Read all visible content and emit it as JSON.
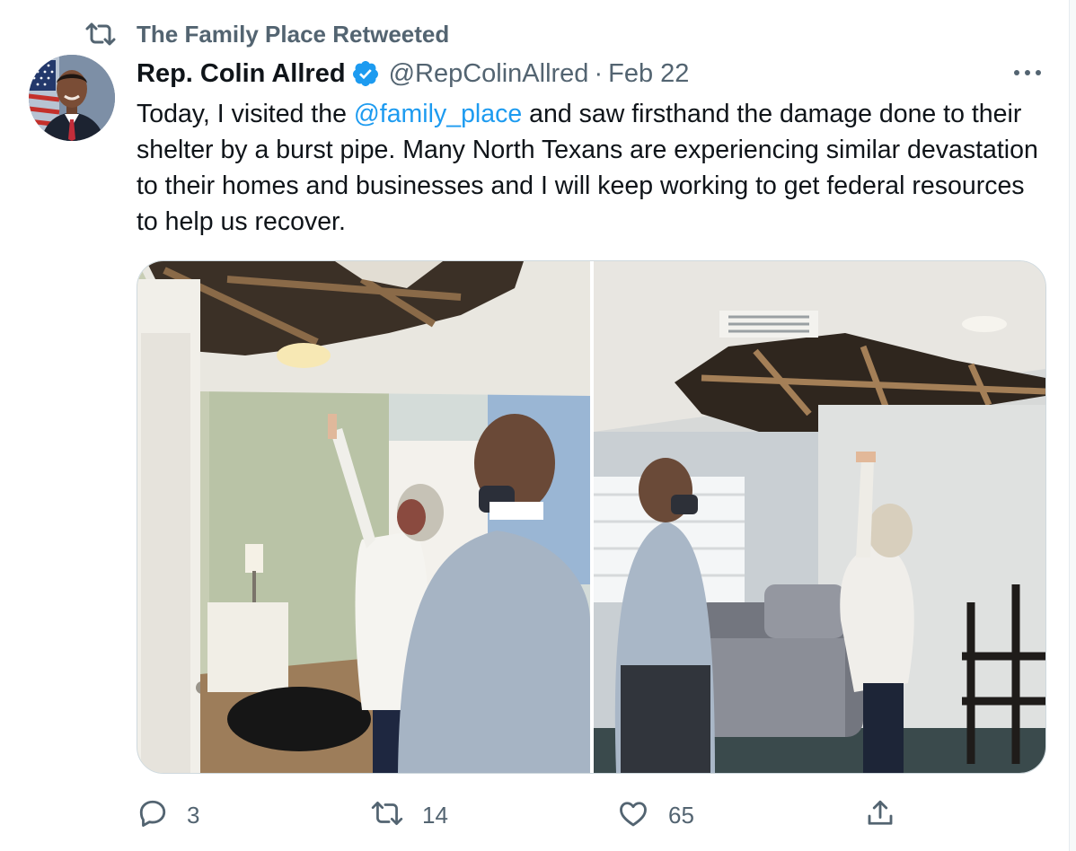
{
  "retweet_context": {
    "icon": "retweet-icon",
    "text": "The Family Place Retweeted"
  },
  "author": {
    "display_name": "Rep. Colin Allred",
    "verified_icon": "verified-badge-icon",
    "handle": "@RepColinAllred",
    "separator": "·",
    "date": "Feb 22"
  },
  "tweet": {
    "text_before": "Today, I visited the ",
    "mention": "@family_place",
    "text_after": " and saw firsthand the damage done to their shelter by a burst pipe. Many North Texans are experiencing similar devastation to their homes and businesses and I will keep working to get federal resources to help us recover."
  },
  "media": {
    "photo_count": 2
  },
  "actions": {
    "reply": {
      "icon": "reply-icon",
      "count": "3"
    },
    "retweet": {
      "icon": "retweet-icon",
      "count": "14"
    },
    "like": {
      "icon": "heart-icon",
      "count": "65"
    },
    "share": {
      "icon": "share-icon"
    }
  },
  "colors": {
    "accent": "#1d9bf0",
    "secondary_text": "#536471",
    "primary_text": "#0f1419",
    "border": "#cfd9de"
  }
}
